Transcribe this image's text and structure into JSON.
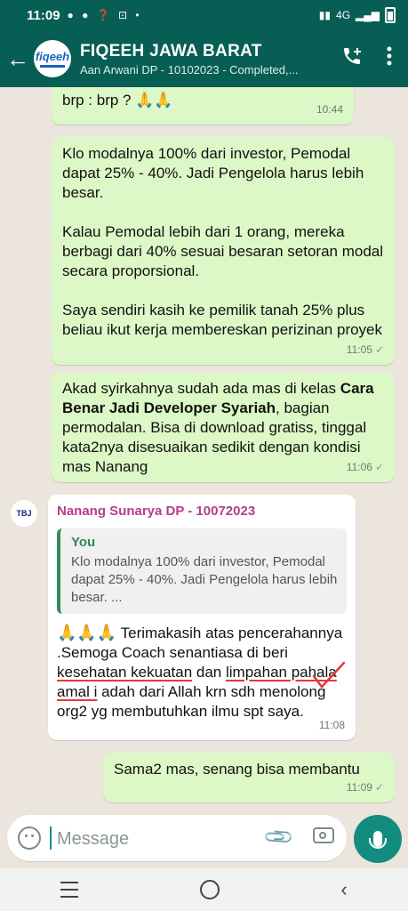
{
  "status_bar": {
    "time": "11:09",
    "network": "4G",
    "left_icons": "● ● ❓ ⊡ •"
  },
  "header": {
    "back_icon": "arrow-left-icon",
    "avatar_text": "fiqeeh",
    "title": "FIQEEH JAWA BARAT",
    "subtitle": "Aan Arwani DP - 10102023 - Completed,...",
    "actions": [
      "add-call-icon",
      "more-vert-icon"
    ]
  },
  "messages": [
    {
      "type": "out",
      "text": "brp : brp ? 🙏🙏",
      "time": "10:44"
    },
    {
      "type": "out",
      "text": "Klo modalnya 100% dari investor, Pemodal dapat 25% - 40%. Jadi Pengelola harus lebih besar.\n\nKalau Pemodal lebih dari 1 orang, mereka berbagi dari 40% sesuai besaran setoran modal secara proporsional.\n\nSaya sendiri kasih ke pemilik tanah 25% plus beliau ikut kerja membereskan perizinan proyek",
      "time": "11:05"
    },
    {
      "type": "out",
      "text_pre": "Akad syirkahnya sudah ada mas di kelas ",
      "text_bold": "Cara Benar Jadi Developer Syariah",
      "text_post": ", bagian permodalan. Bisa di download gratiss, tinggal kata2nya disesuaikan sedikit dengan kondisi mas Nanang",
      "time": "11:06"
    },
    {
      "type": "in",
      "sender": "Nanang Sunarya DP - 10072023",
      "avatar_text": "TBJ",
      "quote_author": "You",
      "quote_text": "Klo modalnya 100% dari investor, Pemodal dapat 25% - 40%. Jadi Pengelola harus lebih besar. ...",
      "emojis": "🙏🙏🙏",
      "text_a": " Terimakasih atas pencerahannya .Semoga Coach senantiasa di beri ",
      "text_u1": "kesehatan kekuatan",
      "text_b": " dan ",
      "text_u2": "limpahan pahala amal i",
      "text_c": " adah dari Allah krn sdh menolong org2 yg membutuhkan ilmu spt saya.",
      "time": "11:08"
    },
    {
      "type": "out",
      "text": "Sama2 mas, senang bisa membantu",
      "time": "11:09"
    }
  ],
  "input": {
    "placeholder": "Message"
  },
  "colors": {
    "header": "#075e54",
    "outgoing": "#dcf8c6",
    "incoming": "#ffffff",
    "chat_bg": "#ece5dd",
    "accent": "#128c7e"
  }
}
